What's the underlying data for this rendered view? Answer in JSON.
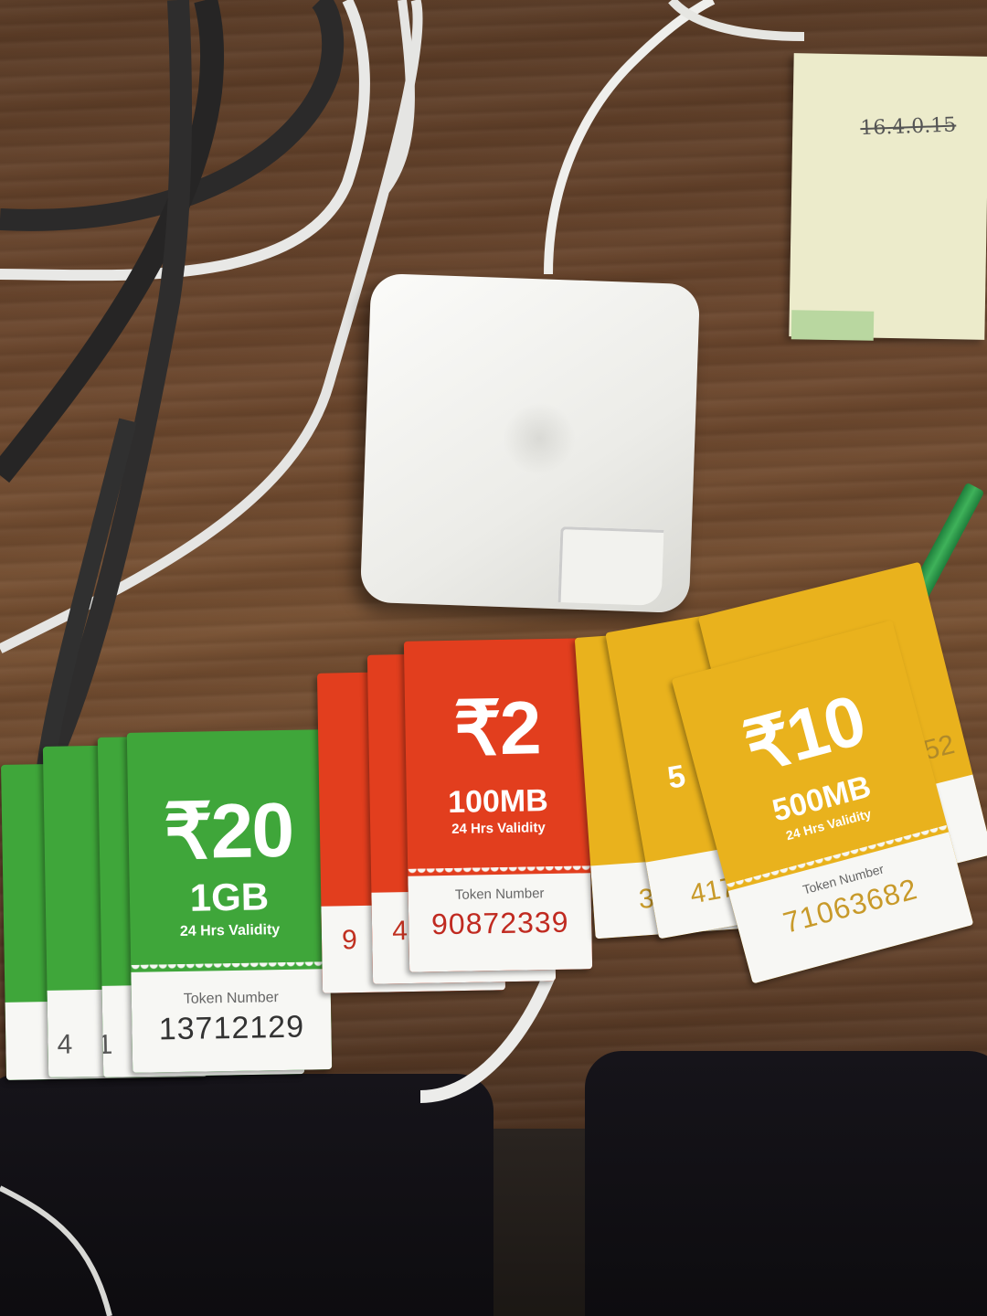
{
  "scene": {
    "description_objects": [
      "desk",
      "laptop-charger",
      "notepad",
      "cables",
      "pencil",
      "voucher-cards"
    ]
  },
  "notepad": {
    "scribble": "16.4.0.15"
  },
  "colors": {
    "green": "#3fa63a",
    "red": "#e23e1e",
    "yellow": "#e9b21d",
    "wood": "#6e4a31"
  },
  "vouchers": [
    {
      "color": "green",
      "price": "₹20",
      "data": "1GB",
      "validity": "24 Hrs Validity",
      "token_label": "Token Number",
      "token_number": "13712129",
      "edge_digits": [
        "4",
        "1"
      ]
    },
    {
      "color": "red",
      "price": "₹2",
      "data": "100MB",
      "validity": "24 Hrs Validity",
      "token_label": "Token Number",
      "token_number": "90872339",
      "edge_digits": [
        "9",
        "4"
      ]
    },
    {
      "color": "yellow",
      "price": "₹10",
      "data": "500MB",
      "validity": "24 Hrs Validity",
      "token_label": "Token Number",
      "token_number": "71063682",
      "edge_digits": [
        "3",
        "417",
        "52",
        "5"
      ]
    }
  ]
}
